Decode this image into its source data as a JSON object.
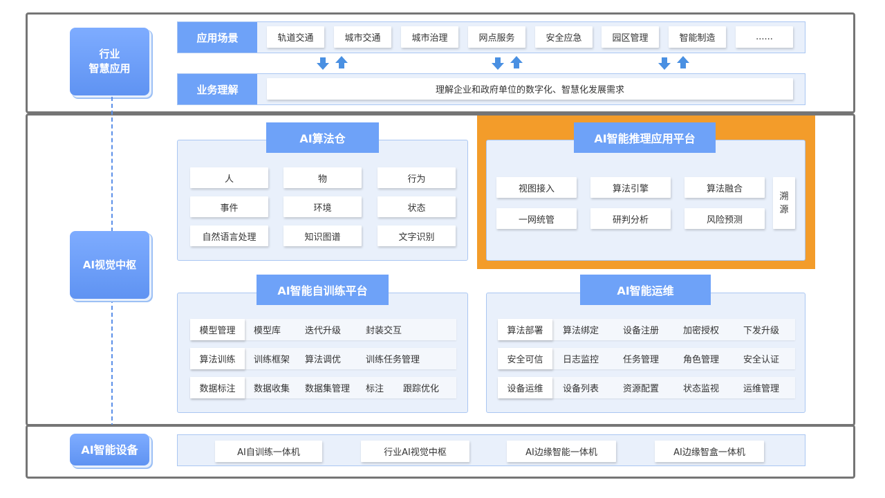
{
  "colors": {
    "section_border": "#757575",
    "accent_blue": "#6ea2f8",
    "panel_bg": "#e9f0fb",
    "panel_border": "#a9c6f2",
    "highlight_orange": "#f39c2a",
    "arrow_blue": "#4a90e2",
    "dash_line": "#5b8fe8"
  },
  "industry": {
    "side_label_line1": "行业",
    "side_label_line2": "智慧应用",
    "scenarios": {
      "title": "应用场景",
      "items": [
        "轨道交通",
        "城市交通",
        "城市治理",
        "网点服务",
        "安全应急",
        "园区管理",
        "智能制造",
        "......"
      ]
    },
    "arrow_icons": [
      "arrow-down-icon",
      "arrow-up-icon"
    ],
    "business": {
      "title": "业务理解",
      "text": "理解企业和政府单位的数字化、智慧化发展需求"
    }
  },
  "vision": {
    "side_label": "AI视觉中枢",
    "algorithm_warehouse": {
      "title": "AI算法仓",
      "items": [
        "人",
        "物",
        "行为",
        "事件",
        "环境",
        "状态",
        "自然语言处理",
        "知识图谱",
        "文字识别"
      ]
    },
    "inference_platform": {
      "title": "AI智能推理应用平台",
      "items": [
        "视图接入",
        "算法引擎",
        "算法融合",
        "一网统管",
        "研判分析",
        "风险预测"
      ],
      "trace_char1": "溯",
      "trace_char2": "源"
    },
    "self_training": {
      "title": "AI智能自训练平台",
      "rows": [
        {
          "key": "模型管理",
          "items": [
            "模型库",
            "迭代升级",
            "封装交互"
          ]
        },
        {
          "key": "算法训练",
          "items": [
            "训练框架",
            "算法调优",
            "训练任务管理"
          ]
        },
        {
          "key": "数据标注",
          "items": [
            "数据收集",
            "数据集管理",
            "标注",
            "跟踪优化"
          ]
        }
      ]
    },
    "ops": {
      "title": "AI智能运维",
      "rows": [
        {
          "key": "算法部署",
          "items": [
            "算法绑定",
            "设备注册",
            "加密授权",
            "下发升级"
          ]
        },
        {
          "key": "安全可信",
          "items": [
            "日志监控",
            "任务管理",
            "角色管理",
            "安全认证"
          ]
        },
        {
          "key": "设备运维",
          "items": [
            "设备列表",
            "资源配置",
            "状态监视",
            "运维管理"
          ]
        }
      ]
    }
  },
  "devices": {
    "side_label": "AI智能设备",
    "items": [
      "AI自训练一体机",
      "行业AI视觉中枢",
      "AI边缘智能一体机",
      "AI边缘智盒一体机"
    ]
  }
}
